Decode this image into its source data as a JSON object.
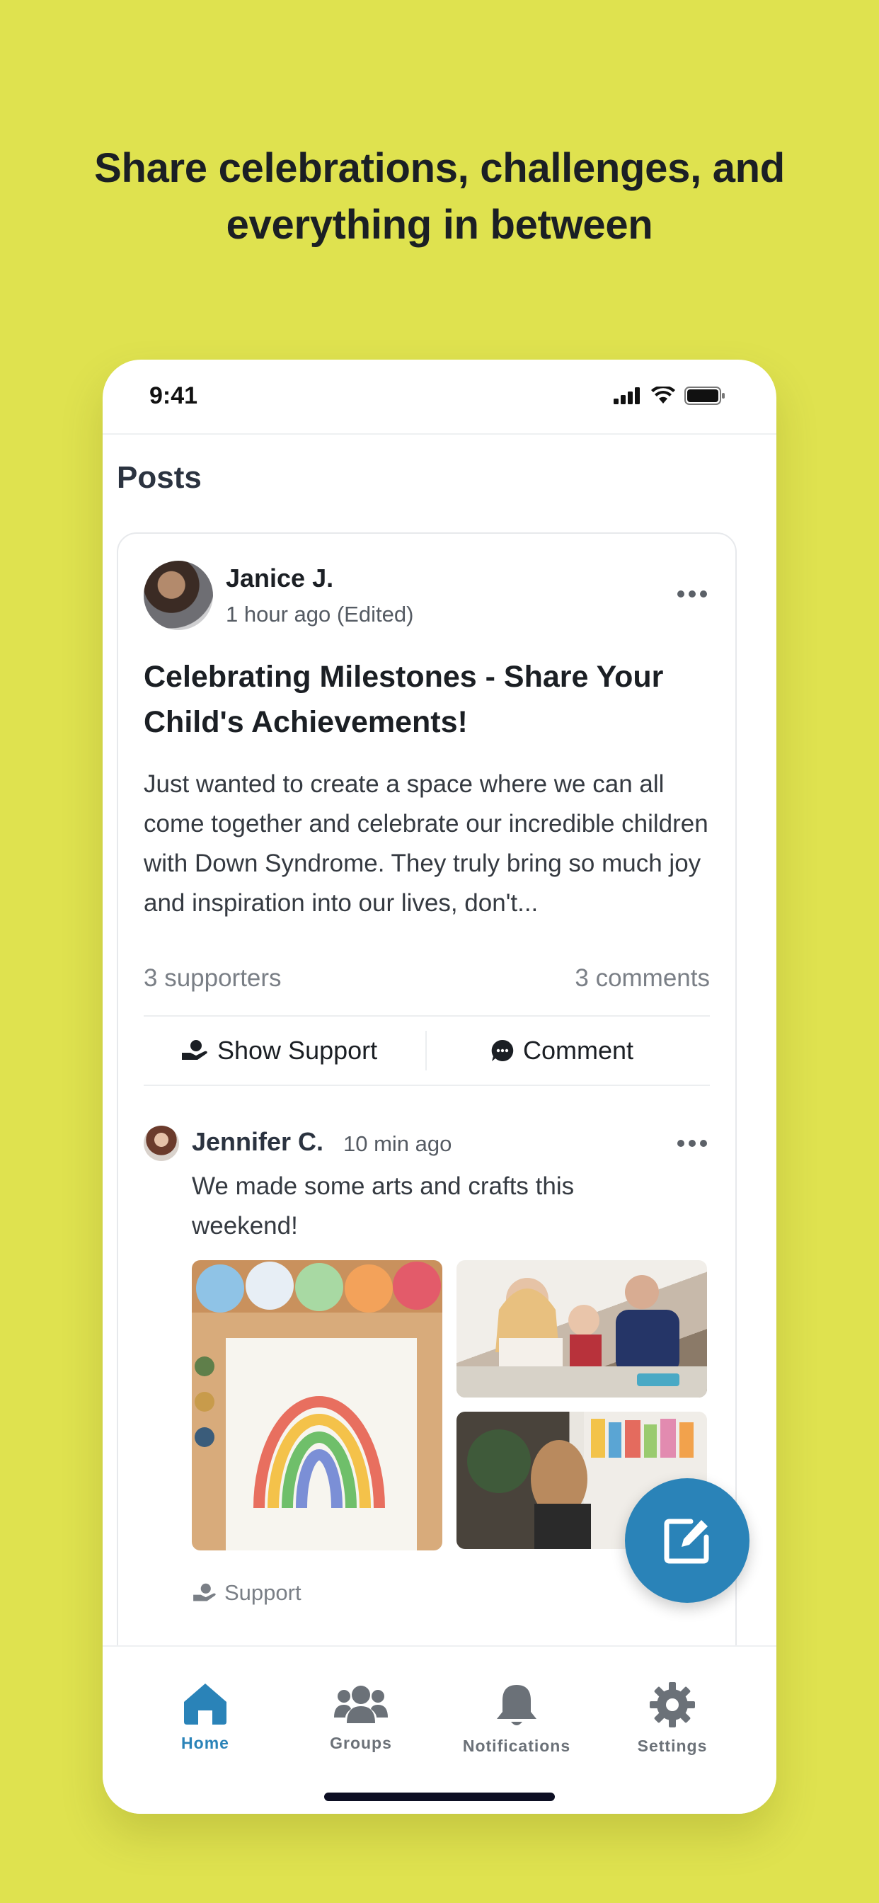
{
  "headline": "Share celebrations, challenges, and everything in between",
  "status_bar": {
    "time": "9:41",
    "icons": [
      "signal-icon",
      "wifi-icon",
      "battery-icon"
    ]
  },
  "page_title": "Posts",
  "post": {
    "author": "Janice J.",
    "meta": "1 hour ago (Edited)",
    "title": "Celebrating Milestones - Share Your Child's Achievements!",
    "body": "Just wanted to create a space where we can all come together and celebrate our incredible children with Down Syndrome. They truly bring so much joy and inspiration into our lives, don't...",
    "supporters": "3 supporters",
    "comments": "3 comments",
    "show_support_label": "Show Support",
    "comment_label": "Comment"
  },
  "comment": {
    "author": "Jennifer C.",
    "time": "10 min ago",
    "body": "We made some arts and crafts this weekend!",
    "support_label": "Support"
  },
  "tabs": [
    {
      "label": "Home",
      "icon": "home-icon",
      "active": true
    },
    {
      "label": "Groups",
      "icon": "groups-icon",
      "active": false
    },
    {
      "label": "Notifications",
      "icon": "bell-icon",
      "active": false
    },
    {
      "label": "Settings",
      "icon": "gear-icon",
      "active": false
    }
  ],
  "colors": {
    "background": "#dfe24f",
    "accent": "#2a83b8",
    "text": "#1b1f24"
  }
}
